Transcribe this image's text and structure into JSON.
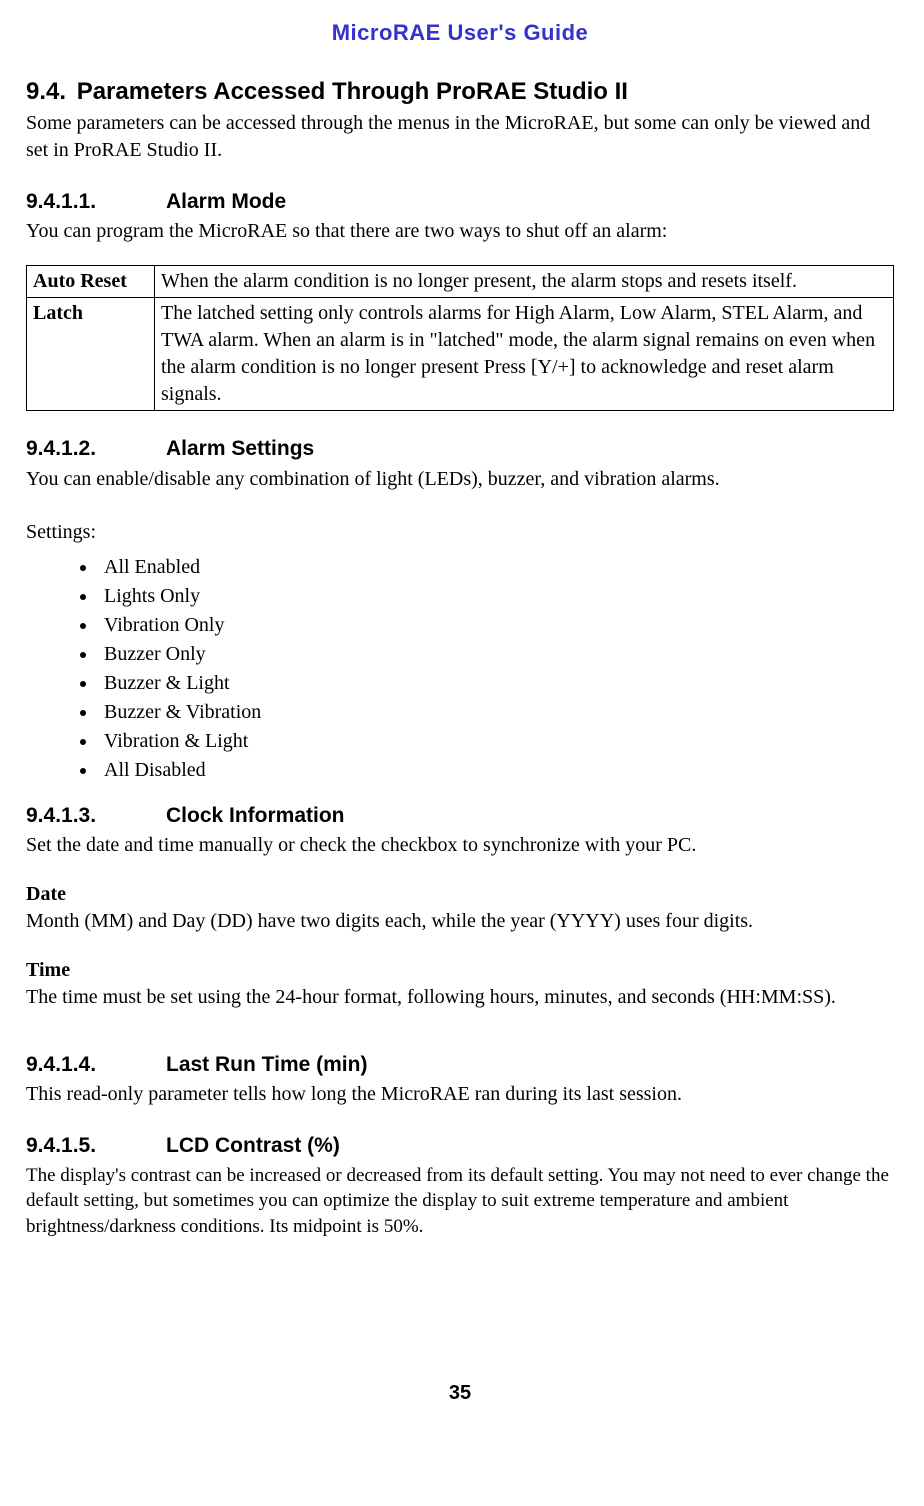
{
  "header": {
    "title": "MicroRAE User's Guide"
  },
  "section94": {
    "num": "9.4.",
    "title": "Parameters Accessed Through ProRAE Studio II",
    "intro": "Some parameters can be accessed through the menus in the MicroRAE, but some can only be viewed and set in ProRAE Studio II."
  },
  "s9411": {
    "num": "9.4.1.1.",
    "title": "Alarm Mode",
    "intro": "You can program the MicroRAE so that there are two ways to shut off an alarm:",
    "table": {
      "row1_label": "Auto Reset",
      "row1_text": "When the alarm condition is no longer present, the alarm stops and resets itself.",
      "row2_label": "Latch",
      "row2_text": "The latched setting only controls alarms for High Alarm, Low Alarm, STEL Alarm, and TWA alarm. When an alarm is in \"latched\" mode, the alarm signal remains on even when the alarm condition is no longer present Press [Y/+] to acknowledge and reset alarm signals."
    }
  },
  "s9412": {
    "num": "9.4.1.2.",
    "title": "Alarm Settings",
    "intro": "You can enable/disable any combination of light (LEDs), buzzer, and vibration alarms.",
    "settings_label": "Settings:",
    "items": [
      "All Enabled",
      "Lights Only",
      "Vibration Only",
      "Buzzer Only",
      "Buzzer & Light",
      "Buzzer & Vibration",
      "Vibration & Light",
      "All Disabled"
    ]
  },
  "s9413": {
    "num": "9.4.1.3.",
    "title": "Clock Information",
    "intro": "Set the date and time manually or check the checkbox to synchronize with your PC.",
    "date_label": "Date",
    "date_text": "Month (MM) and Day (DD) have two digits each, while the year (YYYY) uses four digits.",
    "time_label": "Time",
    "time_text": "The time must be set using the 24-hour format, following hours, minutes, and seconds (HH:MM:SS)."
  },
  "s9414": {
    "num": "9.4.1.4.",
    "title": "Last Run Time (min)",
    "intro": "This read-only parameter tells how long the MicroRAE ran during its last session."
  },
  "s9415": {
    "num": "9.4.1.5.",
    "title": "LCD Contrast (%)",
    "intro": "The display's contrast can be increased or decreased from its default setting. You may not need to ever change the default setting, but sometimes you can optimize the display to suit extreme temperature and ambient brightness/darkness conditions. Its midpoint is 50%."
  },
  "footer": {
    "page": "35"
  }
}
